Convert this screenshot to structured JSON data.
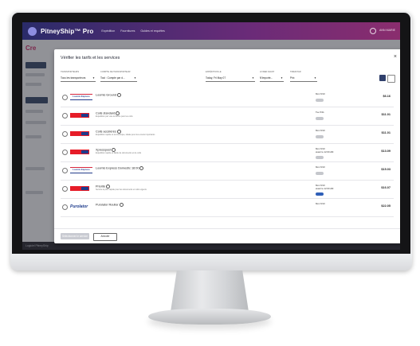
{
  "app": {
    "brand": "PitneyShip™ Pro",
    "nav": [
      "Expédition",
      "Fournitures",
      "Guides et requêtes"
    ],
    "user": "ANN MARIE"
  },
  "background": {
    "title": "Cre",
    "footer_left": "Logiciel PitneyShip",
    "footer_right": ""
  },
  "modal": {
    "title": "Vérifier les tarifs et les services",
    "filters": [
      {
        "label": "TRANSPORTEURS",
        "value": "Tous les transporteurs"
      },
      {
        "label": "COMPTE DE TRANSPORTEUR",
        "value": "Tout : Compte par d..."
      },
      {
        "label": "EXPÉDITION LE",
        "value": "Today, Fri May 07"
      },
      {
        "label": "LIVRER AVANT",
        "value": "N'importe..."
      },
      {
        "label": "TRIER PAR",
        "value": "Prix"
      }
    ],
    "services": [
      {
        "carrier": "loomis",
        "logo_text": "Loomis Express",
        "name": "Loomis Ground",
        "desc": "",
        "delivery": "Mon 5/10",
        "delivery2": "",
        "badge": "gray",
        "price": "$6.16"
      },
      {
        "carrier": "canadapost",
        "logo_text": "",
        "name": "Colis standard",
        "desc": "Expédition par voie terrestre pour les colis",
        "delivery": "Tue 5/11",
        "delivery2": "",
        "badge": "gray",
        "price": "$11.01"
      },
      {
        "carrier": "canadapost",
        "logo_text": "",
        "name": "Colis accélérés",
        "desc": "Expédition rapide et économique, idéale pour les envois importants",
        "delivery": "Mon 5/10",
        "delivery2": "",
        "badge": "gray",
        "price": "$11.01"
      },
      {
        "carrier": "canadapost",
        "logo_text": "",
        "name": "Xpresspost",
        "desc": "Expédition rapide et fiable de documents et de colis",
        "delivery": "Mon 5/10",
        "delivery2": "avant le 12:00 AM",
        "badge": "gray",
        "price": "$13.09"
      },
      {
        "carrier": "loomis",
        "logo_text": "Loomis Express",
        "name": "Loomis Express Domestic 18:00",
        "desc": "",
        "delivery": "Mon 5/10",
        "delivery2": "",
        "badge": "gray",
        "price": "$15.03"
      },
      {
        "carrier": "canadapost",
        "logo_text": "",
        "name": "Priorité",
        "desc": "Service le plus rapide pour les documents et colis urgents",
        "delivery": "Mon 5/10",
        "delivery2": "avant le 12:00 AM",
        "badge": "blue",
        "price": "$16.07"
      },
      {
        "carrier": "purolator",
        "logo_text": "Purolator",
        "name": "Purolator Routier",
        "desc": "",
        "delivery": "Mon 5/10",
        "delivery2": "",
        "badge": "gray",
        "price": "$22.05"
      }
    ],
    "footer": {
      "primary": "Sélectionner le service",
      "secondary": "Annuler"
    }
  },
  "colors": {
    "accent": "#c8326b",
    "header_start": "#2a2b69",
    "header_end": "#8a2d6e",
    "badge_blue": "#2f5fb8",
    "badge_gray": "#c5c7cc"
  }
}
